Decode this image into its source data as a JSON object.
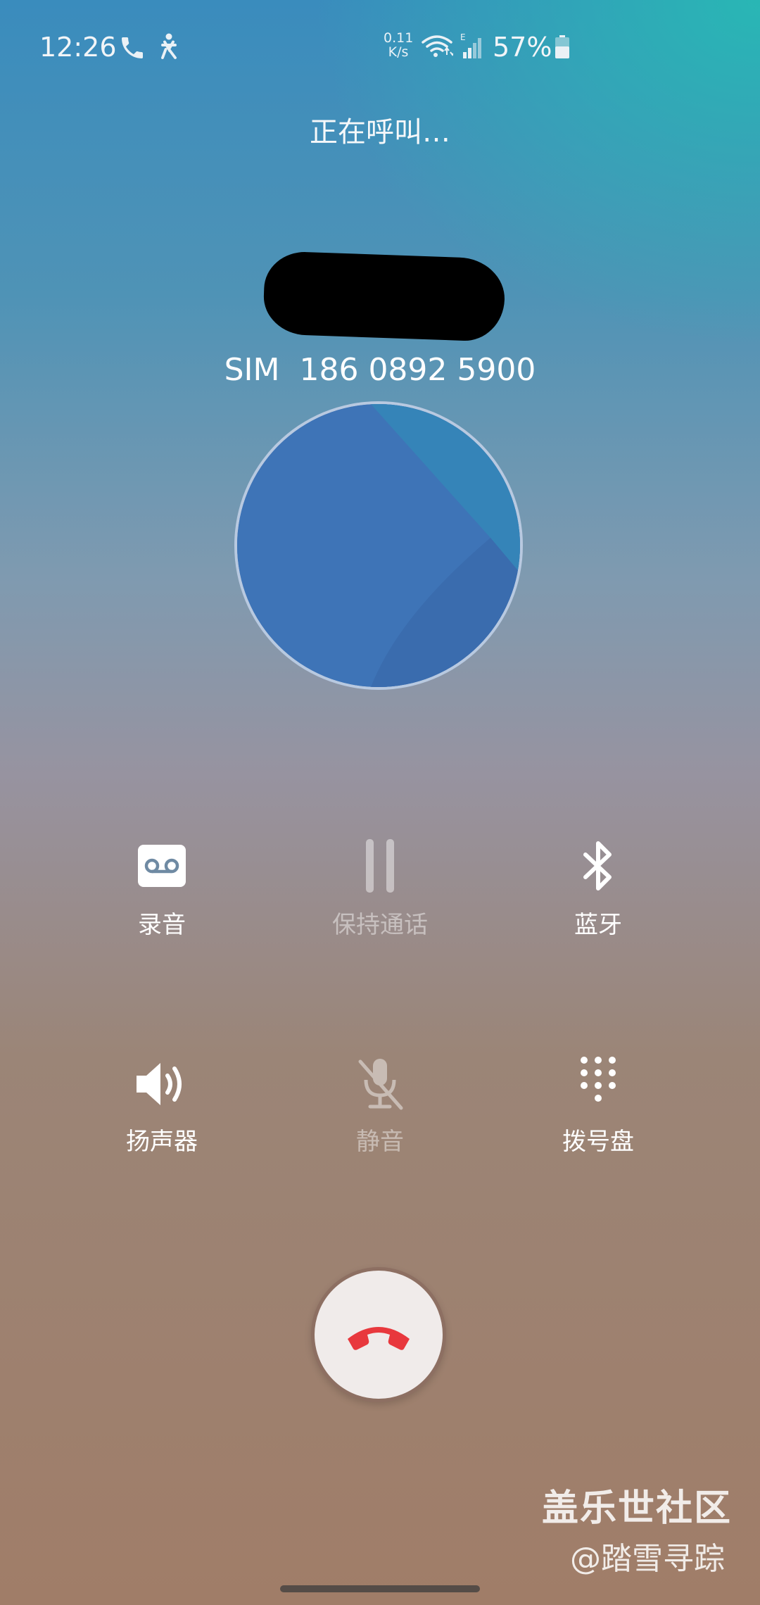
{
  "status_bar": {
    "time": "12:26",
    "net_speed_value": "0.11",
    "net_speed_unit": "K/s",
    "network_type": "E",
    "battery": "57%",
    "icons": [
      "phone-icon",
      "accessibility-icon",
      "wifi-icon",
      "signal-icon",
      "battery-icon"
    ]
  },
  "call": {
    "status": "正在呼叫…",
    "contact_name": "",
    "sim_label": "SIM",
    "number": "186 0892 5900"
  },
  "controls": {
    "record": {
      "label": "录音",
      "icon": "voicemail-icon",
      "enabled": true
    },
    "hold": {
      "label": "保持通话",
      "icon": "pause-icon",
      "enabled": false
    },
    "bluetooth": {
      "label": "蓝牙",
      "icon": "bluetooth-icon",
      "enabled": true
    },
    "speaker": {
      "label": "扬声器",
      "icon": "speaker-icon",
      "enabled": true
    },
    "mute": {
      "label": "静音",
      "icon": "mic-off-icon",
      "enabled": false
    },
    "keypad": {
      "label": "拨号盘",
      "icon": "dialpad-icon",
      "enabled": true
    }
  },
  "end_call": {
    "icon": "hang-up-icon",
    "color": "#e8383d"
  },
  "watermark": {
    "title": "盖乐世社区",
    "handle": "@踏雪寻踪"
  }
}
